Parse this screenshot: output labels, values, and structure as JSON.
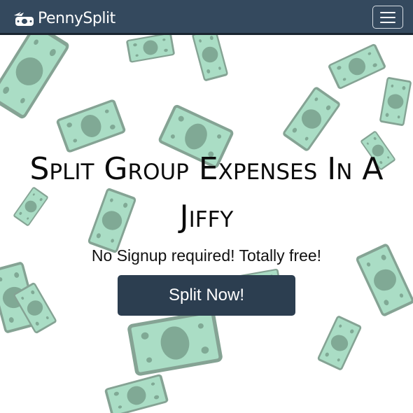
{
  "navbar": {
    "brand_name": "PennySplit",
    "logo_icon": "money-wings-logo-icon",
    "menu_icon": "hamburger-menu-icon",
    "background_color": "#34495e"
  },
  "hero": {
    "title": "Split Group Expenses In A Jiffy",
    "subtitle": "No Signup required! Totally free!",
    "cta_label": "Split Now!",
    "cta_color": "#2c3e50",
    "background_decoration": "flying-money-bills"
  }
}
